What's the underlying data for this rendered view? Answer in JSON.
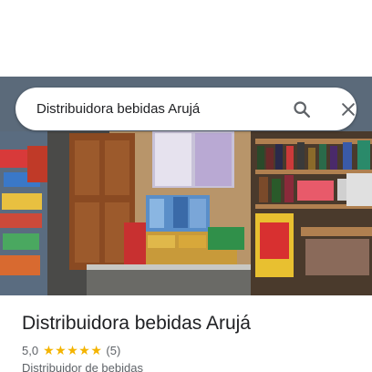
{
  "search": {
    "query": "Distribuidora bebidas Arujá",
    "search_icon": "search-icon",
    "close_icon": "close-icon"
  },
  "place": {
    "name": "Distribuidora bebidas Arujá",
    "rating_value": "5,0",
    "rating": 5,
    "stars": [
      "★",
      "★",
      "★",
      "★",
      "★"
    ],
    "review_count": "(5)",
    "category": "Distribuidor de bebidas"
  },
  "colors": {
    "star": "#f4b400",
    "title": "#202124",
    "secondary_text": "#5f6368"
  }
}
